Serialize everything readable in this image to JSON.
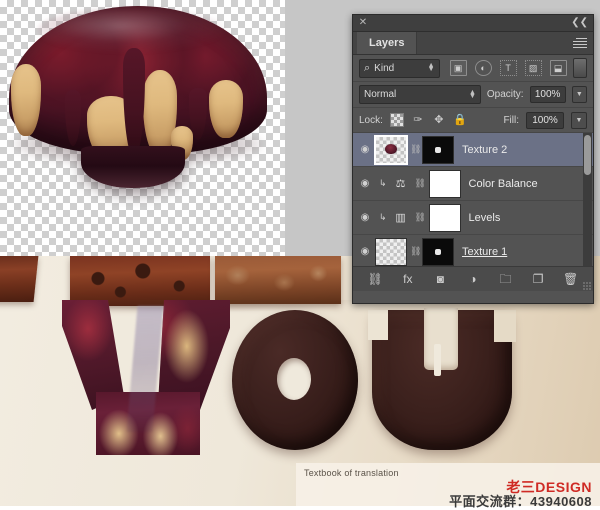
{
  "document": {
    "artwork_title": "chocolate-cake-YOU-composition"
  },
  "panel": {
    "title": "Layers",
    "close_icon": "✕",
    "collapse_icon": "❮❮",
    "menu_icon": "panel-menu-icon",
    "filter": {
      "kind_label": "Kind",
      "search_icon": "⌕",
      "spinner_up": "▲",
      "spinner_down": "▼",
      "icons": [
        {
          "name": "filter-pixel-icon",
          "glyph": "▣"
        },
        {
          "name": "filter-adjustment-icon",
          "glyph": "◐"
        },
        {
          "name": "filter-type-icon",
          "glyph": "T"
        },
        {
          "name": "filter-shape-icon",
          "glyph": "▨"
        },
        {
          "name": "filter-smartobject-icon",
          "glyph": "⬓"
        }
      ],
      "toggle_name": "filter-enable-toggle"
    },
    "blend": {
      "mode": "Normal",
      "opacity_label": "Opacity:",
      "opacity_value": "100%",
      "fill_label": "Fill:",
      "fill_value": "100%",
      "dropdown_glyph": "▼"
    },
    "lock": {
      "label": "Lock:",
      "items": [
        {
          "name": "lock-transparency-icon",
          "glyph": ""
        },
        {
          "name": "lock-image-pixels-icon",
          "glyph": "✑"
        },
        {
          "name": "lock-position-icon",
          "glyph": "✥"
        },
        {
          "name": "lock-all-icon",
          "glyph": "🔒"
        }
      ]
    },
    "layers": [
      {
        "name": "Texture 2",
        "selected": true,
        "visible": true,
        "eye_icon": "◉",
        "chain_icon": "⛓",
        "type": "pixel",
        "has_mask": true,
        "editing": false
      },
      {
        "name": "Color Balance",
        "selected": false,
        "visible": true,
        "eye_icon": "◉",
        "chain_icon": "⛓",
        "type": "adjustment",
        "adj_glyph": "⚖",
        "clip_icon": "↳",
        "has_mask": true,
        "editing": false
      },
      {
        "name": "Levels",
        "selected": false,
        "visible": true,
        "eye_icon": "◉",
        "chain_icon": "⛓",
        "type": "adjustment",
        "adj_glyph": "▥",
        "clip_icon": "↳",
        "has_mask": true,
        "editing": false
      },
      {
        "name": "Texture 1",
        "selected": false,
        "visible": true,
        "eye_icon": "◉",
        "chain_icon": "⛓",
        "type": "pixel",
        "has_mask": true,
        "editing": true
      }
    ],
    "footer": [
      {
        "name": "link-layers-button",
        "glyph": "⛓"
      },
      {
        "name": "layer-styles-button",
        "glyph": "fx"
      },
      {
        "name": "add-layer-mask-button",
        "glyph": "◙"
      },
      {
        "name": "new-adjustment-layer-button",
        "glyph": "◑"
      },
      {
        "name": "new-group-button",
        "glyph": "🗀"
      },
      {
        "name": "new-layer-button",
        "glyph": "❐"
      },
      {
        "name": "delete-layer-button",
        "glyph": "🗑"
      }
    ]
  },
  "watermark": {
    "caption": "Textbook of translation",
    "logo": "老三DESIGN",
    "qq_group": "平面交流群：43940608"
  },
  "colors": {
    "panel_bg": "#535353",
    "selected_row": "#6b7186",
    "artboard_bg": "#efe8da",
    "chocolate": "#3b201d",
    "logo_red": "#cf2a24"
  }
}
